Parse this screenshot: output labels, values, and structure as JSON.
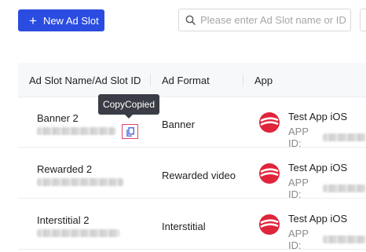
{
  "toolbar": {
    "new_button_label": "New Ad Slot",
    "search_placeholder": "Please enter Ad Slot name or ID"
  },
  "table": {
    "headers": [
      "Ad Slot Name/Ad Slot ID",
      "Ad Format",
      "App"
    ],
    "rows": [
      {
        "name": "Banner 2",
        "format": "Banner",
        "app_name": "Test App iOS",
        "app_id_label": "APP ID:"
      },
      {
        "name": "Rewarded 2",
        "format": "Rewarded video",
        "app_name": "Test App iOS",
        "app_id_label": "APP ID:"
      },
      {
        "name": "Interstitial 2",
        "format": "Interstitial",
        "app_name": "Test App iOS",
        "app_id_label": "APP ID:"
      }
    ]
  },
  "tooltip": {
    "text": "CopyCopied"
  },
  "icons": {
    "new": "plus-icon",
    "search": "search-icon",
    "copy": "copy-icon",
    "app": "app-logo-icon"
  },
  "colors": {
    "primary": "#2b4ce0",
    "tooltip_bg": "#3a3d45",
    "logo": "#e0243a",
    "copy_highlight": "#e0456a"
  }
}
